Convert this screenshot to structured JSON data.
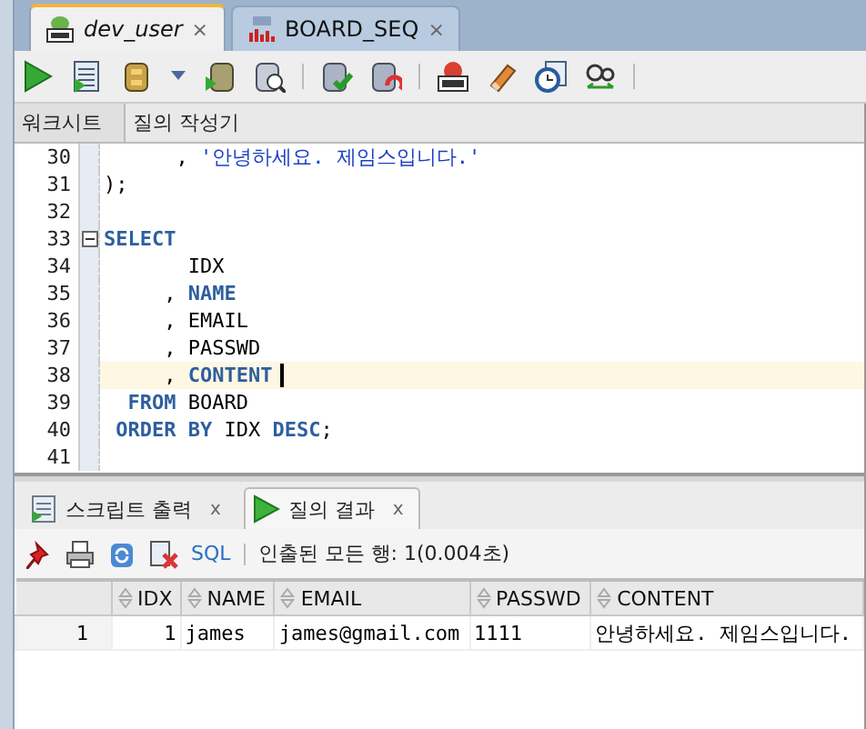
{
  "editor_tabs": [
    {
      "label": "dev_user",
      "close": "×",
      "selected": true,
      "kind": "sql"
    },
    {
      "label": "BOARD_SEQ",
      "close": "×",
      "selected": false,
      "kind": "sequence"
    }
  ],
  "sub_tabs": [
    {
      "label": "워크시트",
      "selected": true
    },
    {
      "label": "질의 작성기",
      "selected": false
    }
  ],
  "code_lines": [
    {
      "number": "30",
      "collapsible": false,
      "current": false,
      "tokens": [
        {
          "kind": "plain",
          "text": "      , "
        },
        {
          "kind": "string",
          "text": "'안녕하세요. 제임스입니다.'"
        }
      ]
    },
    {
      "number": "31",
      "collapsible": false,
      "current": false,
      "tokens": [
        {
          "kind": "plain",
          "text": ");"
        }
      ]
    },
    {
      "number": "32",
      "collapsible": false,
      "current": false
    },
    {
      "number": "33",
      "collapsible": true,
      "current": false,
      "tokens": [
        {
          "kind": "keyword",
          "text": "SELECT"
        }
      ]
    },
    {
      "number": "34",
      "collapsible": false,
      "current": false,
      "tokens": [
        {
          "kind": "plain",
          "text": "       IDX"
        }
      ]
    },
    {
      "number": "35",
      "collapsible": false,
      "current": false,
      "tokens": [
        {
          "kind": "plain",
          "text": "     , "
        },
        {
          "kind": "keyword",
          "text": "NAME"
        }
      ]
    },
    {
      "number": "36",
      "collapsible": false,
      "current": false,
      "tokens": [
        {
          "kind": "plain",
          "text": "     , EMAIL"
        }
      ]
    },
    {
      "number": "37",
      "collapsible": false,
      "current": false,
      "tokens": [
        {
          "kind": "plain",
          "text": "     , PASSWD"
        }
      ]
    },
    {
      "number": "38",
      "collapsible": false,
      "current": true,
      "tokens": [
        {
          "kind": "plain",
          "text": "     , "
        },
        {
          "kind": "keyword",
          "text": "CONTENT"
        }
      ]
    },
    {
      "number": "39",
      "collapsible": false,
      "current": false,
      "tokens": [
        {
          "kind": "keyword",
          "text": "  FROM"
        },
        {
          "kind": "plain",
          "text": " BOARD"
        }
      ]
    },
    {
      "number": "40",
      "collapsible": false,
      "current": false,
      "tokens": [
        {
          "kind": "keyword",
          "text": " ORDER BY"
        },
        {
          "kind": "plain",
          "text": " IDX "
        },
        {
          "kind": "keyword",
          "text": "DESC"
        },
        {
          "kind": "plain",
          "text": ";"
        }
      ]
    },
    {
      "number": "41",
      "collapsible": false,
      "current": false
    }
  ],
  "result_tabs": [
    {
      "label": "스크립트 출력",
      "close": "x",
      "selected": false,
      "kind": "script"
    },
    {
      "label": "질의 결과",
      "close": "x",
      "selected": true,
      "kind": "query"
    }
  ],
  "result_toolbar": {
    "sql_link": "SQL",
    "status": "인출된 모든 행: 1(0.004초)"
  },
  "table": {
    "columns": [
      "IDX",
      "NAME",
      "EMAIL",
      "PASSWD",
      "CONTENT"
    ],
    "rows": [
      {
        "number": "1",
        "cells": [
          "1",
          "james",
          "james@gmail.com",
          "1111",
          "안녕하세요. 제임스입니다."
        ]
      }
    ]
  }
}
